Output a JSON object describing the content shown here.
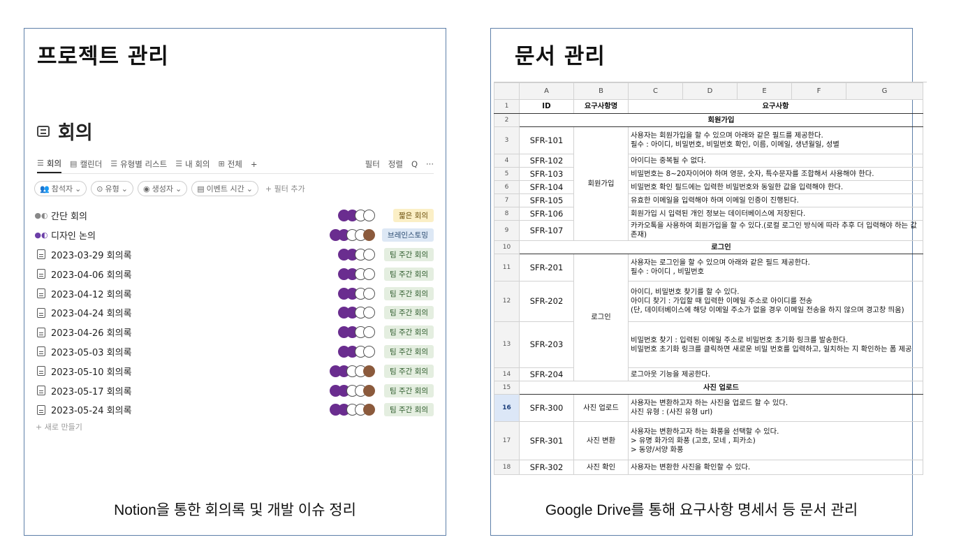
{
  "left": {
    "title": "프로젝트 관리",
    "db_title": "회의",
    "tabs": [
      "회의",
      "캘린더",
      "유형별 리스트",
      "내 회의",
      "전체",
      "+"
    ],
    "tab_actions": [
      "필터",
      "정렬",
      "Q",
      "···"
    ],
    "filters": [
      "참석자",
      "유형",
      "생성자",
      "이벤트 시간"
    ],
    "add_filter": "+ 필터 추가",
    "rows": [
      {
        "name": "간단 회의",
        "tag": "짧은 회의",
        "tag_color": "yellow"
      },
      {
        "name": "디자인 논의",
        "tag": "브레인스토밍",
        "tag_color": "blue"
      },
      {
        "name": "2023-03-29 회의록",
        "tag": "팀 주간 회의",
        "tag_color": "green"
      },
      {
        "name": "2023-04-06 회의록",
        "tag": "팀 주간 회의",
        "tag_color": "green"
      },
      {
        "name": "2023-04-12 회의록",
        "tag": "팀 주간 회의",
        "tag_color": "green"
      },
      {
        "name": "2023-04-24 회의록",
        "tag": "팀 주간 회의",
        "tag_color": "green"
      },
      {
        "name": "2023-04-26 회의록",
        "tag": "팀 주간 회의",
        "tag_color": "green"
      },
      {
        "name": "2023-05-03 회의록",
        "tag": "팀 주간 회의",
        "tag_color": "green"
      },
      {
        "name": "2023-05-10 회의록",
        "tag": "팀 주간 회의",
        "tag_color": "green"
      },
      {
        "name": "2023-05-17 회의록",
        "tag": "팀 주간 회의",
        "tag_color": "green"
      },
      {
        "name": "2023-05-24 회의록",
        "tag": "팀 주간 회의",
        "tag_color": "green"
      }
    ],
    "new_row": "+ 새로 만들기",
    "caption": "Notion을 통한 회의록 및 개발 이슈 정리"
  },
  "right": {
    "title": "문서 관리",
    "col_letters": [
      "A",
      "B",
      "C",
      "D",
      "E",
      "F",
      "G"
    ],
    "header": {
      "id": "ID",
      "name": "요구사항명",
      "req": "요구사항"
    },
    "sections": {
      "join": "회원가입",
      "login": "로그인",
      "photo": "사진 업로드"
    },
    "groups": {
      "join": "회원가입",
      "login": "로그인"
    },
    "reqs": {
      "r3_id": "SFR-101",
      "r3_a": "사용자는 회원가입을 할 수 있으며 아래와 같은 필드를 제공한다.",
      "r3_b": "필수 : 아이디, 비밀번호, 비밀번호 확인, 이름, 이메일, 생년월일, 성별",
      "r4_id": "SFR-102",
      "r4_a": "아이디는 중복될 수 없다.",
      "r5_id": "SFR-103",
      "r5_a": "비밀번호는 8~20자이어야 하며 영문, 숫자, 특수문자를 조합해서 사용해야 한다.",
      "r6_id": "SFR-104",
      "r6_a": "비밀번호 확인 필드에는 입력한 비밀번호와 동일한 값을 입력해야 한다.",
      "r7_id": "SFR-105",
      "r7_a": "유효한 이메일을 입력해야 하며 이메일 인증이 진행된다.",
      "r8_id": "SFR-106",
      "r8_a": "회원가입 시 입력된 개인 정보는 데이터베이스에 저장된다.",
      "r9_id": "SFR-107",
      "r9_a": "카카오톡을 사용하여 회원가입을 할 수 있다.(로컬 로그인 방식에 따라 추후 더 입력해야 하는 값 존재)",
      "r11_id": "SFR-201",
      "r11_a": "사용자는 로그인을 할 수 있으며 아래와 같은 필드 제공한다.",
      "r11_b": "필수 : 아이디 , 비밀번호",
      "r12_id": "SFR-202",
      "r12_a": "아이디, 비밀번호 찾기를 할 수 있다.",
      "r12_b": "아이디 찾기 : 가입할 때 입력한 이메일 주소로 아이디를 전송",
      "r12_c": "(단, 데이터베이스에 해당 이메일 주소가 없을 경우 이메일 전송을 하지 않으며 경고창 띄움)",
      "r13_id": "SFR-203",
      "r13_a": "비밀번호 찾기 : 입력된 이메일 주소로 비밀번호 초기화 링크를 발송한다.",
      "r13_b": "비밀번호 초기화 링크를 클릭하면 새로운 비밀 번호를 입력하고, 일치하는 지 확인하는 폼 제공",
      "r14_id": "SFR-204",
      "r14_a": "로그아웃 기능을 제공한다.",
      "r16_id": "SFR-300",
      "r16_name": "사진 업로드",
      "r16_a": "사용자는 변환하고자 하는 사진을 업로드 할 수 있다.",
      "r16_b": "사진 유형 : (사진 유형 url)",
      "r17_id": "SFR-301",
      "r17_name": "사진 변환",
      "r17_a": "사용자는 변환하고자 하는 화풍을 선택할 수 있다.",
      "r17_b": "> 유명 화가의 화풍 (고흐, 모네 , 피카소)",
      "r17_c": "> 동양/서양 화풍",
      "r18_id": "SFR-302",
      "r18_name": "사진 확인",
      "r18_a": "사용자는 변환한 사진을 확인할 수 있다."
    },
    "caption": "Google Drive를 통해 요구사항 명세서 등 문서 관리"
  }
}
